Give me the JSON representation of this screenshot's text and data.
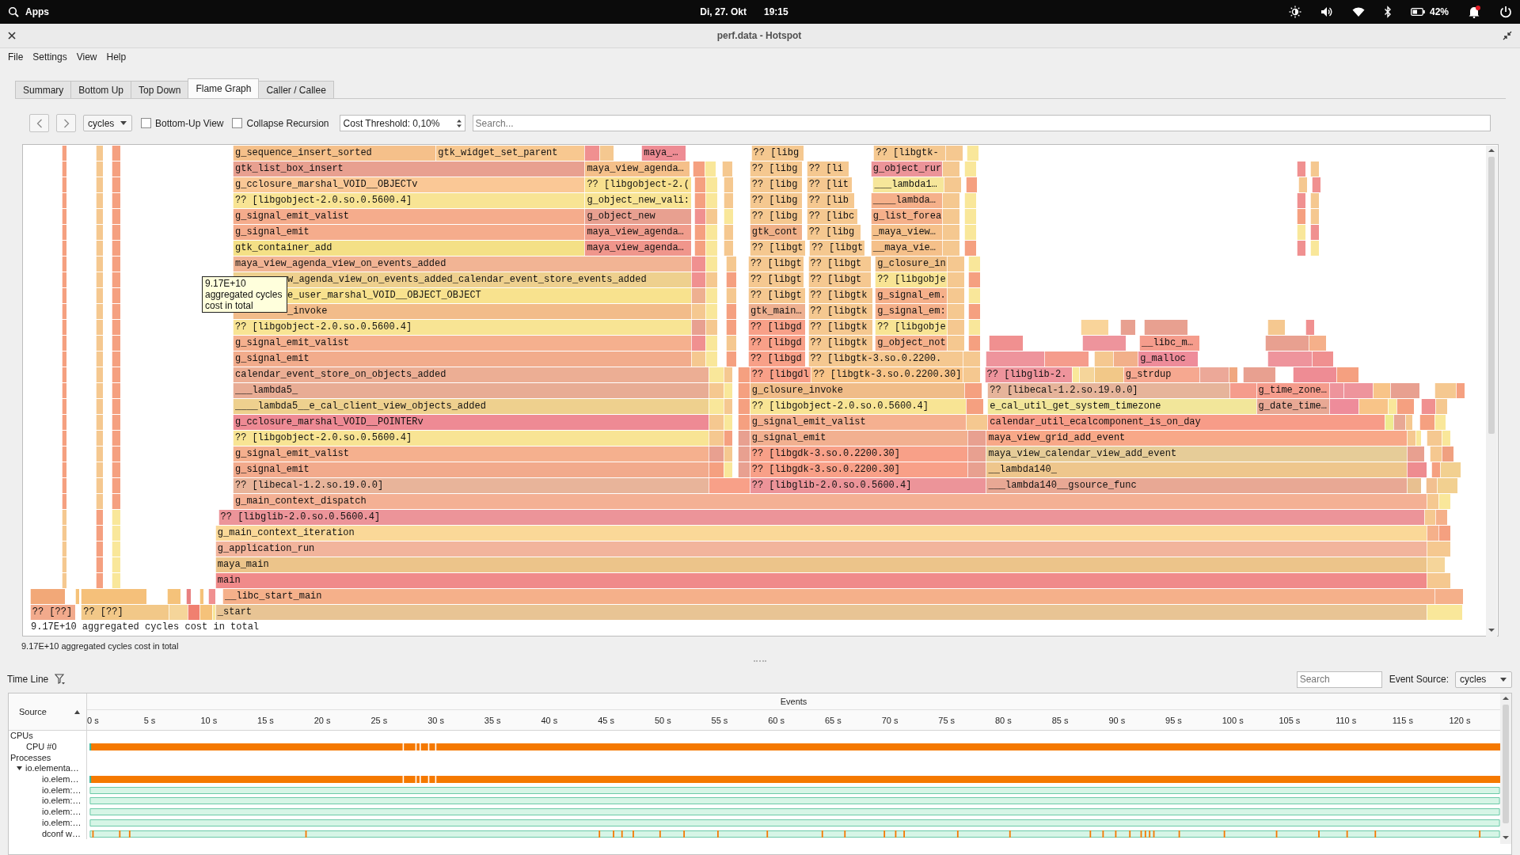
{
  "top_bar": {
    "apps_label": "Apps",
    "date": "Di, 27. Okt",
    "time": "19:15",
    "battery": "42%"
  },
  "window": {
    "title": "perf.data - Hotspot"
  },
  "menu": [
    "File",
    "Settings",
    "View",
    "Help"
  ],
  "tabs": [
    {
      "label": "Summary",
      "selected": false
    },
    {
      "label": "Bottom Up",
      "selected": false
    },
    {
      "label": "Top Down",
      "selected": false
    },
    {
      "label": "Flame Graph",
      "selected": true
    },
    {
      "label": "Caller / Callee",
      "selected": false
    }
  ],
  "toolbar": {
    "cost_type": "cycles",
    "options": [
      {
        "label": "Bottom-Up View",
        "checked": false
      },
      {
        "label": "Collapse Recursion",
        "checked": false
      }
    ],
    "threshold": "Cost Threshold: 0,10%",
    "search": {
      "placeholder": "Search..."
    }
  },
  "flame_graph": {
    "rows": [
      {
        "frames": [
          {
            "label": "g_sequence_insert_sorted"
          },
          {
            "label": "gtk_widget_set_parent"
          },
          {
            "label": "maya_…"
          },
          {
            "label": "?? [libg"
          },
          {
            "label": "?? [libgtk-"
          }
        ]
      },
      {
        "frames": [
          {
            "label": "gtk_list_box_insert"
          },
          {
            "label": "maya_view_agenda…"
          },
          {
            "label": "?? [libg"
          },
          {
            "label": "?? [li"
          },
          {
            "label": "g_object_rur"
          }
        ]
      },
      {
        "frames": [
          {
            "label": "g_cclosure_marshal_VOID__OBJECTv"
          },
          {
            "label": "?? [libgobject-2.("
          },
          {
            "label": "?? [libg"
          },
          {
            "label": "?? [lit"
          },
          {
            "label": "___lambda1…"
          }
        ]
      },
      {
        "frames": [
          {
            "label": "?? [libgobject-2.0.so.0.5600.4]"
          },
          {
            "label": "g_object_new_vali:"
          },
          {
            "label": "?? [libg"
          },
          {
            "label": "?? [lib"
          },
          {
            "label": "____lambda…"
          }
        ]
      },
      {
        "frames": [
          {
            "label": "g_signal_emit_valist"
          },
          {
            "label": "g_object_new"
          },
          {
            "label": "?? [libg"
          },
          {
            "label": "?? [libc"
          },
          {
            "label": "g_list_forea"
          }
        ]
      },
      {
        "frames": [
          {
            "label": "g_signal_emit"
          },
          {
            "label": "maya_view_agenda…"
          },
          {
            "label": "gtk_cont"
          },
          {
            "label": "?? [libg"
          },
          {
            "label": "_maya_view…"
          }
        ]
      },
      {
        "frames": [
          {
            "label": "gtk_container_add"
          },
          {
            "label": "maya_view_agenda…"
          },
          {
            "label": "?? [libgt"
          },
          {
            "label": "?? [libgt"
          },
          {
            "label": "__maya_vie…"
          }
        ]
      },
      {
        "frames": [
          {
            "label": "maya_view_agenda_view_on_events_added"
          },
          {
            "label": "?? [libgt"
          },
          {
            "label": "?? [libgt"
          },
          {
            "label": "g_closure_in"
          }
        ]
      },
      {
        "frames": [
          {
            "label": "w_agenda_view_on_events_added_calendar_event_store_events_added"
          },
          {
            "label": "?? [libgt"
          },
          {
            "label": "?? [libgt"
          },
          {
            "label": "?? [libgobje"
          }
        ]
      },
      {
        "frames": [
          {
            "label": "e_user_marshal_VOID__OBJECT_OBJECT"
          },
          {
            "label": "?? [libgt"
          },
          {
            "label": "?? [libgtk"
          },
          {
            "label": "g_signal_em."
          }
        ]
      },
      {
        "frames": [
          {
            "label": "_invoke"
          },
          {
            "label": "gtk_main…"
          },
          {
            "label": "?? [libgtk"
          },
          {
            "label": "g_signal_em:"
          }
        ]
      },
      {
        "frames": [
          {
            "label": "?? [libgobject-2.0.so.0.5600.4]"
          },
          {
            "label": "?? [libgd"
          },
          {
            "label": "?? [libgtk"
          },
          {
            "label": "?? [libgobje"
          }
        ]
      },
      {
        "frames": [
          {
            "label": "g_signal_emit_valist"
          },
          {
            "label": "?? [libgd"
          },
          {
            "label": "?? [libgtk"
          },
          {
            "label": "g_object_not"
          },
          {
            "label": "__libc_m…"
          }
        ]
      },
      {
        "frames": [
          {
            "label": "g_signal_emit"
          },
          {
            "label": "?? [libgd"
          },
          {
            "label": "?? [libgtk-3.so.0.2200."
          },
          {
            "label": "g_malloc"
          }
        ]
      },
      {
        "frames": [
          {
            "label": "calendar_event_store_on_objects_added"
          },
          {
            "label": "?? [libgdl"
          },
          {
            "label": "?? [libgtk-3.so.0.2200.30]"
          },
          {
            "label": "?? [libglib-2."
          },
          {
            "label": "g_strdup"
          }
        ]
      },
      {
        "frames": [
          {
            "label": "___lambda5_"
          },
          {
            "label": "g_closure_invoke"
          },
          {
            "label": "?? [libecal-1.2.so.19.0.0]"
          },
          {
            "label": "g_time_zone…"
          }
        ]
      },
      {
        "frames": [
          {
            "label": "____lambda5__e_cal_client_view_objects_added"
          },
          {
            "label": "?? [libgobject-2.0.so.0.5600.4]"
          },
          {
            "label": "e_cal_util_get_system_timezone"
          },
          {
            "label": "g_date_time…"
          }
        ]
      },
      {
        "frames": [
          {
            "label": "g_cclosure_marshal_VOID__POINTERv"
          },
          {
            "label": "g_signal_emit_valist"
          },
          {
            "label": "calendar_util_ecalcomponent_is_on_day"
          }
        ]
      },
      {
        "frames": [
          {
            "label": "?? [libgobject-2.0.so.0.5600.4]"
          },
          {
            "label": "g_signal_emit"
          },
          {
            "label": "maya_view_grid_add_event"
          }
        ]
      },
      {
        "frames": [
          {
            "label": "g_signal_emit_valist"
          },
          {
            "label": "?? [libgdk-3.so.0.2200.30]"
          },
          {
            "label": "maya_view_calendar_view_add_event"
          }
        ]
      },
      {
        "frames": [
          {
            "label": "g_signal_emit"
          },
          {
            "label": "?? [libgdk-3.so.0.2200.30]"
          },
          {
            "label": "__lambda140_"
          }
        ]
      },
      {
        "frames": [
          {
            "label": "?? [libecal-1.2.so.19.0.0]"
          },
          {
            "label": "?? [libglib-2.0.so.0.5600.4]"
          },
          {
            "label": "___lambda140__gsource_func"
          }
        ]
      },
      {
        "frames": [
          {
            "label": "g_main_context_dispatch"
          }
        ]
      },
      {
        "frames": [
          {
            "label": "?? [libglib-2.0.so.0.5600.4]"
          }
        ]
      },
      {
        "frames": [
          {
            "label": "g_main_context_iteration"
          }
        ]
      },
      {
        "frames": [
          {
            "label": "g_application_run"
          }
        ]
      },
      {
        "frames": [
          {
            "label": "maya_main"
          }
        ]
      },
      {
        "frames": [
          {
            "label": "main"
          }
        ]
      },
      {
        "frames": [
          {
            "label": "__libc_start_main"
          }
        ]
      },
      {
        "frames": [
          {
            "label": "?? [??]"
          },
          {
            "label": "?? [??]"
          },
          {
            "label": "_start"
          }
        ]
      }
    ],
    "footer": "9.17E+10 aggregated cycles cost in total",
    "tooltip": "9.17E+10 aggregated cycles cost in total"
  },
  "summary": "9.17E+10 aggregated cycles cost in total",
  "timeline": {
    "title": "Time Line",
    "search": {
      "placeholder": "Search"
    },
    "event_source_label": "Event Source:",
    "event_source": "cycles",
    "source_header": "Source",
    "events_header": "Events",
    "ticks": [
      "0 s",
      "5 s",
      "10 s",
      "15 s",
      "20 s",
      "25 s",
      "30 s",
      "35 s",
      "40 s",
      "45 s",
      "50 s",
      "55 s",
      "60 s",
      "65 s",
      "70 s",
      "75 s",
      "80 s",
      "85 s",
      "90 s",
      "95 s",
      "100 s",
      "105 s",
      "110 s",
      "115 s",
      "120 s"
    ],
    "rows": [
      {
        "label": "CPUs",
        "children": [
          {
            "label": "CPU #0",
            "kind": "busy"
          }
        ]
      },
      {
        "label": "Processes",
        "children": [
          {
            "label": "io.elementa…",
            "expanded": true,
            "children": [
              {
                "label": "io.elem…",
                "kind": "busy"
              },
              {
                "label": "io.elem:…",
                "kind": "idle"
              },
              {
                "label": "io.elem:…",
                "kind": "idle"
              },
              {
                "label": "io.elem:…",
                "kind": "idle"
              },
              {
                "label": "io.elem:…",
                "kind": "idle"
              },
              {
                "label": "dconf w…",
                "kind": "sparse"
              }
            ]
          }
        ]
      }
    ]
  }
}
